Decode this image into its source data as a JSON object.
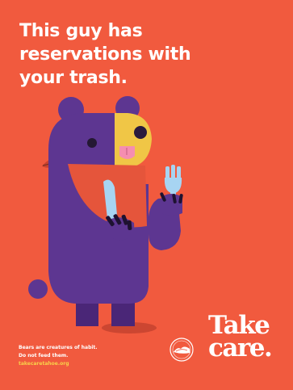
{
  "headline": {
    "lines": [
      "This guy has",
      "reservations with",
      "your trash."
    ]
  },
  "footer": {
    "line1": "Bears are creatures of habit.",
    "line2": "Do not feed them.",
    "url": "takecaretahoe.org"
  },
  "brand": {
    "line1": "Take",
    "line2": "care."
  },
  "icons": {
    "bear": "bear-illustration-icon",
    "leaf": "leaf-icon",
    "knife": "knife-icon",
    "fork": "fork-icon",
    "seal": "lake-tahoe-seal-icon"
  },
  "colors": {
    "background": "#f15a3e",
    "bear": "#5d3691",
    "bear_dark": "#4a2677",
    "muzzle": "#f0c646",
    "napkin": "#e5553b",
    "utensil": "#a7d4f2",
    "tongue": "#f58eb0",
    "text": "#ffffff",
    "url": "#f8d14a"
  }
}
